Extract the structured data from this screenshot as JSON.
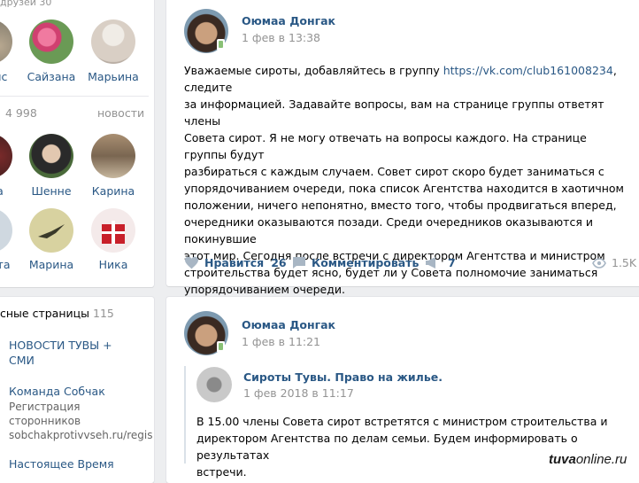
{
  "left": {
    "friends_header_partial": "друзей",
    "friends_row1": [
      "ыс",
      "Сайзана",
      "Марьина"
    ],
    "followers_count": "4 998",
    "followers_link": "новости",
    "friends_row2": [
      "а",
      "Шенне",
      "Карина"
    ],
    "friends_row3": [
      "ита",
      "Марина",
      "Ника"
    ],
    "pages": {
      "title": "сные страницы",
      "count": "115",
      "items": [
        {
          "line1": "НОВОСТИ ТУВЫ +",
          "line2": "СМИ"
        },
        {
          "line1": "Команда Собчак",
          "sub1": "Регистрация",
          "sub2": "сторонников",
          "sub3": "sobchakprotivvseh.ru/regis"
        },
        {
          "line1": "Настоящее Время"
        }
      ]
    }
  },
  "post1": {
    "author": "Оюмаа Донгак",
    "date": "1 фев в 13:38",
    "text_lines": [
      [
        "Уважаемые сироты, добавляйтесь в группу ",
        "https://vk.com/club161008234",
        ", следите"
      ],
      [
        "за информацией. Задавайте вопросы, вам на странице группы ответят члены"
      ],
      [
        "Совета сирот. Я не могу отвечать на вопросы каждого. На странице группы будут"
      ],
      [
        "разбираться с каждым случаем. Совет сирот скоро будет заниматься с"
      ],
      [
        "упорядочиванием очереди, пока список Агентства находится в хаотичном"
      ],
      [
        "положении, ничего непонятно, вместо того, чтобы продвигаться вперед,"
      ],
      [
        "очередники оказываются позади. Среди очередников оказываются и покинувшие"
      ],
      [
        "этот мир. Сегодня после встречи с директором Агентства и министром"
      ],
      [
        "строительства будет ясно, будет ли у Совета полномочие заниматься"
      ],
      [
        "упорядочиванием очереди."
      ]
    ],
    "like_label": "Нравится",
    "like_count": "26",
    "comment_label": "Комментировать",
    "share_count": "7",
    "views": "1.5K"
  },
  "post2": {
    "author": "Оюмаа Донгак",
    "date": "1 фев в 11:21",
    "repost_author": "Сироты Тувы. Право на жилье.",
    "repost_date": "1 фев 2018 в 11:17",
    "text_lines": [
      "В 15.00 члены Совета сирот встретятся с министром строительства и",
      "директором Агентства по делам семьи. Будем информировать о результатах",
      "встречи."
    ]
  },
  "watermark": {
    "bold": "tuva",
    "rest": "online.ru"
  },
  "colors": {
    "link": "#2a5885",
    "bg": "#edeef0",
    "muted": "#939393",
    "icon": "#a8b6c4"
  }
}
